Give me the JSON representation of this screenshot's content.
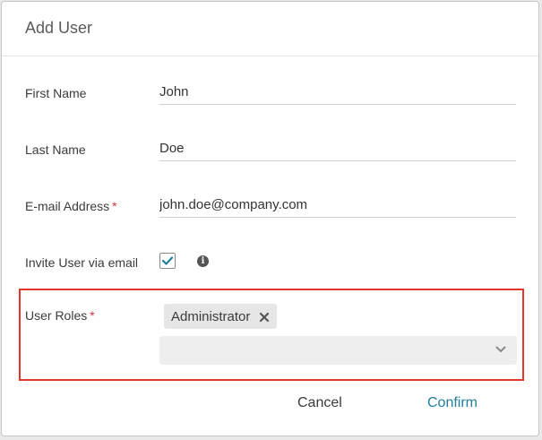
{
  "dialog": {
    "title": "Add User"
  },
  "form": {
    "first_name": {
      "label": "First Name",
      "value": "John",
      "required": false
    },
    "last_name": {
      "label": "Last Name",
      "value": "Doe",
      "required": false
    },
    "email": {
      "label": "E-mail Address",
      "value": "john.doe@company.com",
      "required": true,
      "required_mark": "*"
    },
    "invite": {
      "label": "Invite User via email",
      "checked": true,
      "info_icon": "info-icon"
    },
    "roles": {
      "label": "User Roles",
      "required": true,
      "required_mark": "*",
      "selected": [
        "Administrator"
      ],
      "dropdown_value": ""
    }
  },
  "actions": {
    "cancel_label": "Cancel",
    "confirm_label": "Confirm"
  },
  "colors": {
    "accent": "#1f7e9a",
    "required": "#d9303f",
    "highlight_border": "#e8352b"
  }
}
